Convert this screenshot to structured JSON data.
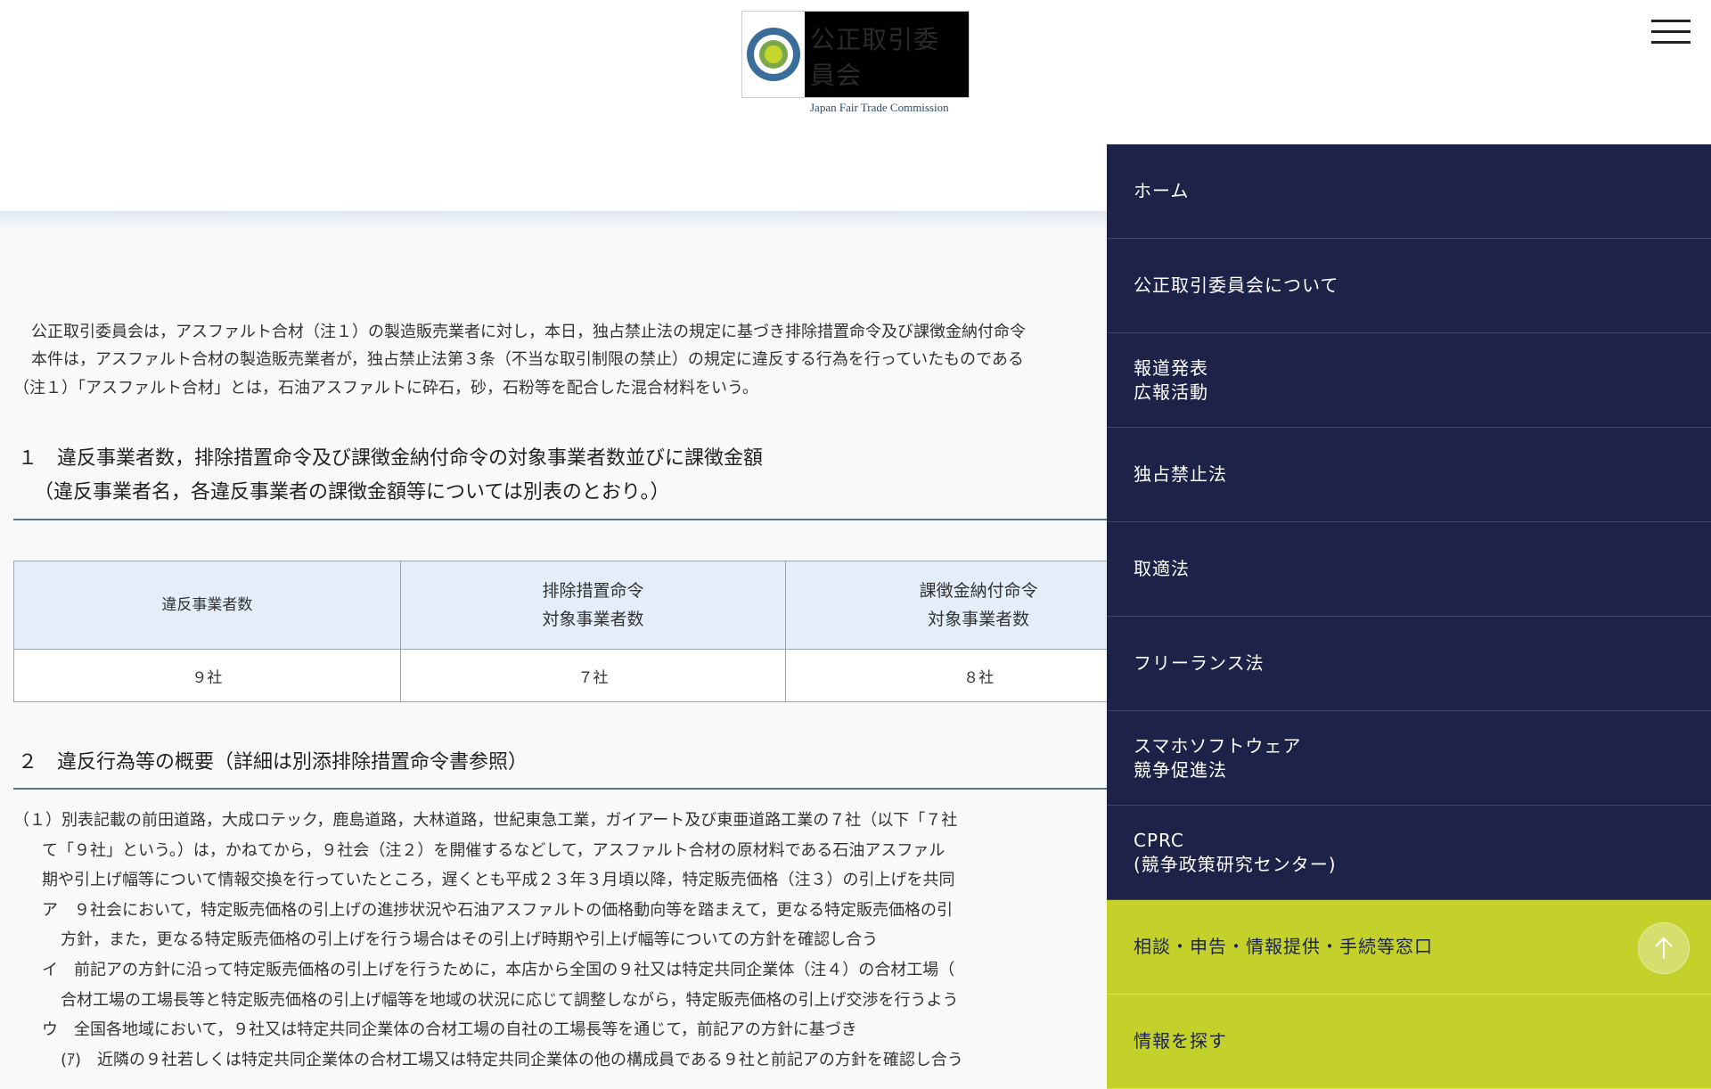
{
  "logo": {
    "jp": "公正取引委員会",
    "en": "Japan Fair Trade Commission"
  },
  "intro": [
    "公正取引委員会は，アスファルト合材（注１）の製造販売業者に対し，本日，独占禁止法の規定に基づき排除措置命令及び課徴金納付命令",
    "本件は，アスファルト合材の製造販売業者が，独占禁止法第３条（不当な取引制限の禁止）の規定に違反する行為を行っていたものである",
    "（注１）「アスファルト合材」とは，石油アスファルトに砕石，砂，石粉等を配合した混合材料をいう。"
  ],
  "section1": {
    "title": "１　違反事業者数，排除措置命令及び課徴金納付命令の対象事業者数並びに課徴金額",
    "subtitle": "（違反事業者名，各違反事業者の課徴金額等については別表のとおり。）"
  },
  "table": {
    "headers": [
      [
        "違反事業者数"
      ],
      [
        "排除措置命令",
        "対象事業者数"
      ],
      [
        "課徴金納付命令",
        "対象事業者数"
      ]
    ],
    "values": [
      "９社",
      "７社",
      "８社"
    ]
  },
  "section2": {
    "title": "２　違反行為等の概要（詳細は別添排除措置命令書参照）",
    "lines": [
      "（１）別表記載の前田道路，大成ロテック，鹿島道路，大林道路，世紀東急工業，ガイアート及び東亜道路工業の７社（以下「７社",
      "て「９社」という。）は，かねてから，９社会（注２）を開催するなどして，アスファルト合材の原材料である石油アスファル",
      "期や引上げ幅等について情報交換を行っていたところ，遅くとも平成２３年３月頃以降，特定販売価格（注３）の引上げを共同",
      "ア　９社会において，特定販売価格の引上げの進捗状況や石油アスファルトの価格動向等を踏まえて，更なる特定販売価格の引",
      "方針，また，更なる特定販売価格の引上げを行う場合はその引上げ時期や引上げ幅等についての方針を確認し合う",
      "イ　前記アの方針に沿って特定販売価格の引上げを行うために，本店から全国の９社又は特定共同企業体（注４）の合材工場（",
      "合材工場の工場長等と特定販売価格の引上げ幅等を地域の状況に応じて調整しながら，特定販売価格の引上げ交渉を行うよう",
      "ウ　全国各地域において，９社又は特定共同企業体の合材工場の自社の工場長等を通じて，前記アの方針に基づき",
      "(ｱ)　近隣の９社若しくは特定共同企業体の合材工場又は特定共同企業体の他の構成員である９社と前記アの方針を確認し合う"
    ]
  },
  "menu": [
    [
      "ホーム"
    ],
    [
      "公正取引委員会について"
    ],
    [
      "報道発表",
      "広報活動"
    ],
    [
      "独占禁止法"
    ],
    [
      "取適法"
    ],
    [
      "フリーランス法"
    ],
    [
      "スマホソフトウェア",
      "競争促進法"
    ],
    [
      "CPRC",
      "(競争政策研究センター)"
    ],
    [
      "相談・申告・情報提供・手続等窓口"
    ],
    [
      "情報を探す"
    ]
  ],
  "colors": {
    "menu_bg": "#1d2348",
    "menu_accent": "#c3d12a"
  }
}
